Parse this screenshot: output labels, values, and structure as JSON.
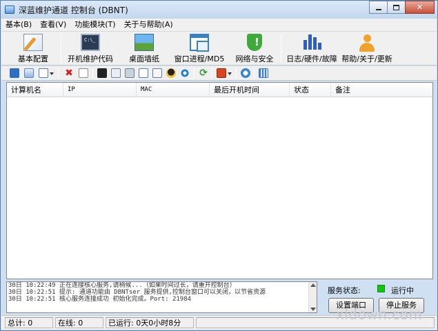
{
  "window": {
    "title": "深蓝维护通道 控制台 (DBNT)",
    "close_label": "✕"
  },
  "menu": [
    "基本(B)",
    "查看(V)",
    "功能模块(T)",
    "关于与帮助(A)"
  ],
  "big_toolbar": [
    {
      "label": "基本配置",
      "icon": "config-icon"
    },
    {
      "label": "开机维护代码",
      "icon": "console-icon"
    },
    {
      "label": "桌面墙纸",
      "icon": "desktop-wallpaper-icon"
    },
    {
      "label": "窗口进程/MD5",
      "icon": "window-process-icon"
    },
    {
      "label": "网络与安全",
      "icon": "shield-icon"
    },
    {
      "label": "日志/硬件/故障",
      "icon": "bar-chart-icon"
    },
    {
      "label": "帮助/关于/更新",
      "icon": "user-icon"
    }
  ],
  "list": {
    "columns": [
      "计算机名",
      "IP",
      "MAC",
      "最后开机时间",
      "状态",
      "备注"
    ],
    "rows": []
  },
  "log": [
    "30日 10:22:49 正在连接核心服务,请稍候...（如果时间过长，请重开控制台）",
    "30日 10:22:51 提示: 通道功能由 DBNTser 服务提供,控制台窗口可以关闭，以节省资源",
    "30日 10:22:51 核心服务连接成功 初始化完成。Port: 21984"
  ],
  "service": {
    "label": "服务状态:",
    "state": "运行中",
    "state_color": "#13c413",
    "set_port_label": "设置端口",
    "stop_label": "停止服务"
  },
  "status": {
    "total": "总计: 0",
    "online": "在线: 0",
    "uptime": "已运行: 0天0小时8分"
  },
  "watermark": "xldown.com"
}
